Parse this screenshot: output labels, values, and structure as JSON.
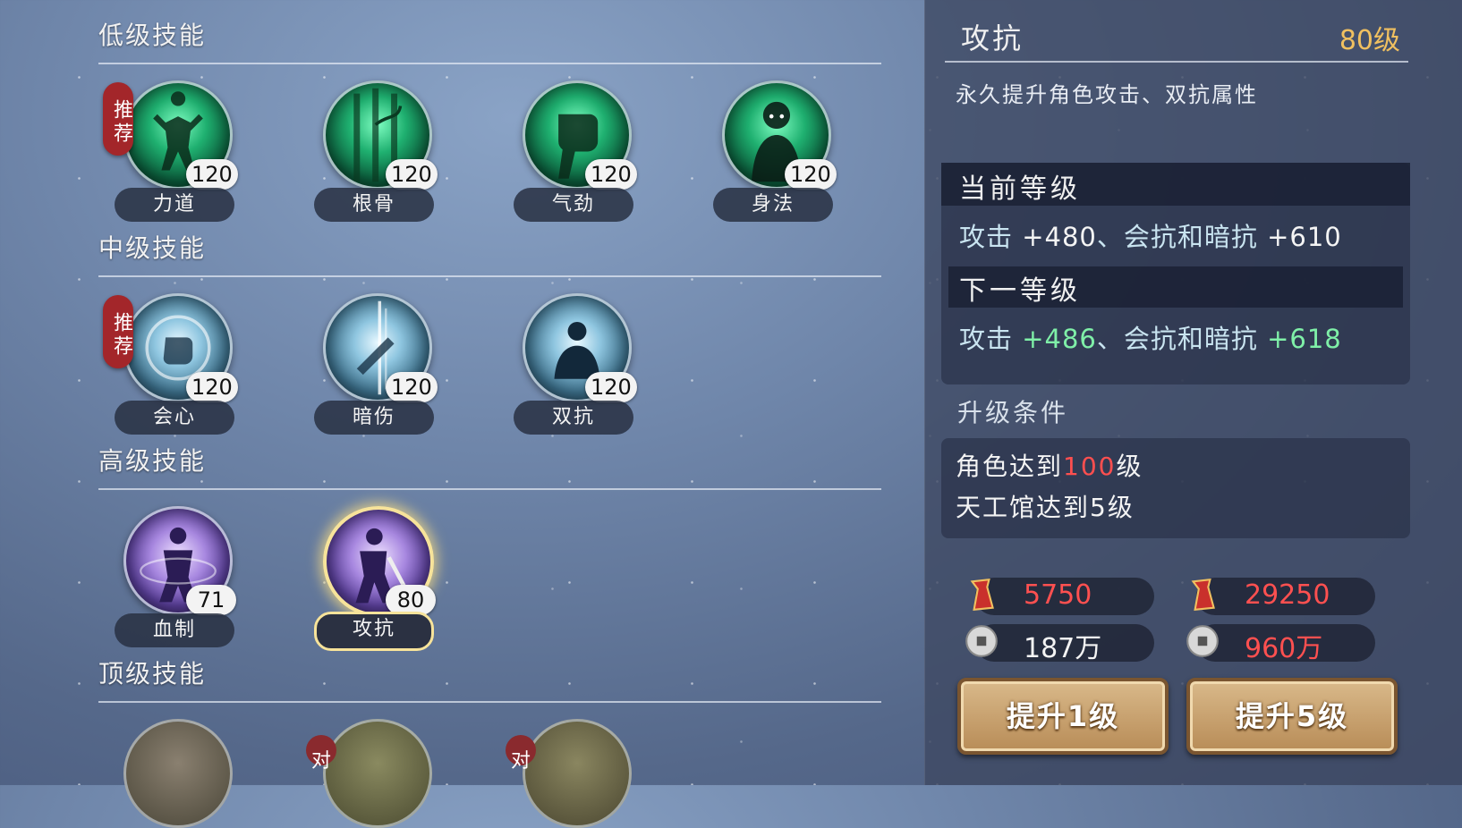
{
  "sections": [
    {
      "title": "低级技能"
    },
    {
      "title": "中级技能"
    },
    {
      "title": "高级技能"
    },
    {
      "title": "顶级技能"
    }
  ],
  "recommend_label": "推荐",
  "skills": {
    "low": [
      {
        "name": "力道",
        "level": "120",
        "icon": "muscle-figure-icon",
        "recommended": true
      },
      {
        "name": "根骨",
        "level": "120",
        "icon": "vine-bamboo-icon",
        "recommended": false
      },
      {
        "name": "气劲",
        "level": "120",
        "icon": "fist-swirl-icon",
        "recommended": false
      },
      {
        "name": "身法",
        "level": "120",
        "icon": "warrior-bust-icon",
        "recommended": false
      }
    ],
    "mid": [
      {
        "name": "会心",
        "level": "120",
        "icon": "glowing-fist-icon",
        "recommended": true
      },
      {
        "name": "暗伤",
        "level": "120",
        "icon": "hidden-blade-icon",
        "recommended": false
      },
      {
        "name": "双抗",
        "level": "120",
        "icon": "meditating-figure-icon",
        "recommended": false
      }
    ],
    "high": [
      {
        "name": "血制",
        "level": "71",
        "icon": "aura-figure-icon",
        "recommended": false
      },
      {
        "name": "攻抗",
        "level": "80",
        "icon": "sword-fighter-icon",
        "recommended": false,
        "selected": true
      }
    ],
    "top_partial_labels": [
      "对",
      "对"
    ]
  },
  "detail": {
    "title": "攻抗",
    "level": "80级",
    "description": "永久提升角色攻击、双抗属性",
    "current_label": "当前等级",
    "current_stat": {
      "a": "攻击 ",
      "b": "+480",
      "c": "、会抗和暗抗 ",
      "d": "+610"
    },
    "next_label": "下一等级",
    "next_stat": {
      "a": "攻击 ",
      "b": "+486",
      "c": "、会抗和暗抗 ",
      "d": "+618"
    },
    "req_title": "升级条件",
    "req1": {
      "a": "角色达到",
      "b": "100",
      "c": "级"
    },
    "req2": "天工馆达到5级",
    "costs_1": {
      "scroll": "5750",
      "coin": "187万"
    },
    "costs_5": {
      "scroll": "29250",
      "coin": "960万"
    },
    "btn1": "提升1级",
    "btn5": "提升5级"
  },
  "colors": {
    "accent_gold": "#f0c060",
    "insufficient_red": "#ff5050",
    "next_green": "#7ff0a8"
  }
}
